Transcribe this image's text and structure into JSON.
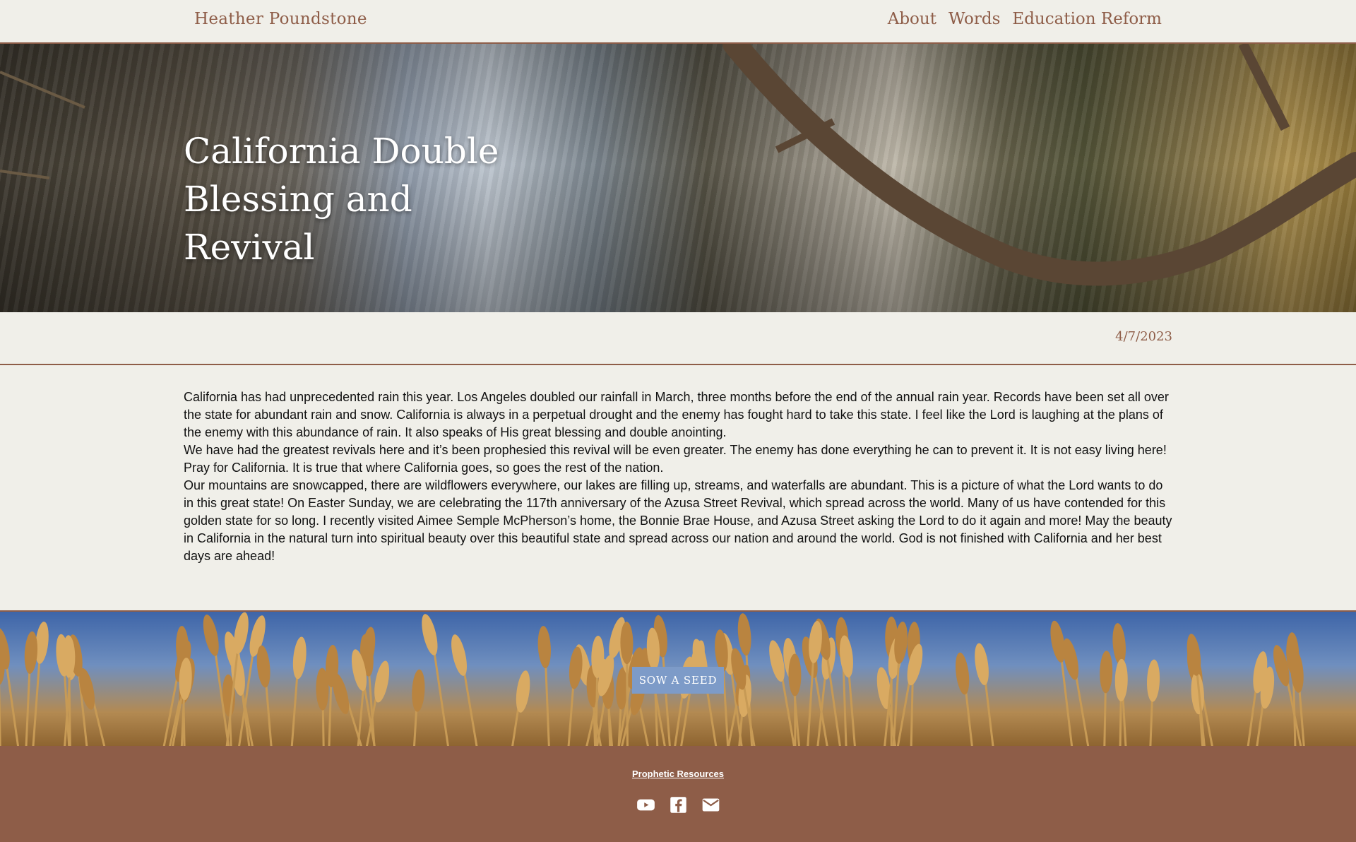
{
  "site": {
    "brand": "Heather Poundstone"
  },
  "nav": {
    "items": [
      {
        "label": "About"
      },
      {
        "label": "Words"
      },
      {
        "label": "Education Reform"
      }
    ]
  },
  "hero": {
    "title": "California Double Blessing and Revival"
  },
  "post": {
    "date": "4/7/2023"
  },
  "article": {
    "paragraphs": [
      "California has had unprecedented rain this year.   Los Angeles doubled our rainfall in March, three months before the end of the annual rain year.   Records have been set all over the state for abundant rain and snow.  California is always in a perpetual drought and the enemy has fought hard to take this state.   I feel like the Lord is laughing at the plans of the enemy with this abundance of rain.  It also speaks of His great blessing and double anointing.",
      "We have had the greatest revivals here and it’s been prophesied this revival will be even greater.  The enemy has done everything he can to prevent it.  It is not easy living here!  Pray for California.  It is true that where California goes, so goes the rest of the nation.",
      "Our mountains are snowcapped, there are wildflowers everywhere, our lakes are filling up, streams, and waterfalls are abundant.  This is a picture of what the Lord wants to do in this great state!  On Easter Sunday, we are celebrating the 117th anniversary of the Azusa Street Revival, which spread across the world.  Many of us have contended for this golden state for so long.  I recently visited Aimee Semple McPherson’s home, the Bonnie Brae House, and Azusa Street asking the Lord to do it again and more!  May the beauty in California in the natural turn into spiritual beauty over this beautiful state and spread across our nation and around the world.  God is not finished with California and her best days are ahead!"
    ]
  },
  "cta": {
    "label": "SOW A SEED"
  },
  "footer": {
    "link": "Prophetic Resources",
    "socials": [
      {
        "icon": "youtube-icon"
      },
      {
        "icon": "facebook-icon"
      },
      {
        "icon": "email-icon"
      }
    ]
  },
  "colors": {
    "accent": "#8e5d48",
    "background": "#f0efe9",
    "button": "#7d9bc8"
  }
}
